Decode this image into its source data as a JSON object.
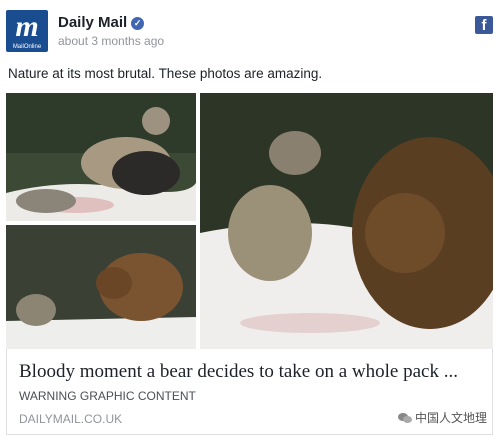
{
  "post": {
    "publisher": "Daily Mail",
    "time": "about 3 months ago",
    "logo_big": "m",
    "logo_small": "MailOnline",
    "caption": "Nature at its most brutal. These photos are amazing."
  },
  "link": {
    "title": "Bloody moment a bear decides to take on a whole pack ...",
    "description": "WARNING GRAPHIC CONTENT",
    "domain": "DAILYMAIL.CO.UK"
  },
  "watermark": "中国人文地理",
  "icons": {
    "verified": "verified-badge-icon",
    "facebook": "facebook-icon"
  },
  "colors": {
    "brand": "#1a4d8f",
    "facebook": "#3b5998"
  }
}
